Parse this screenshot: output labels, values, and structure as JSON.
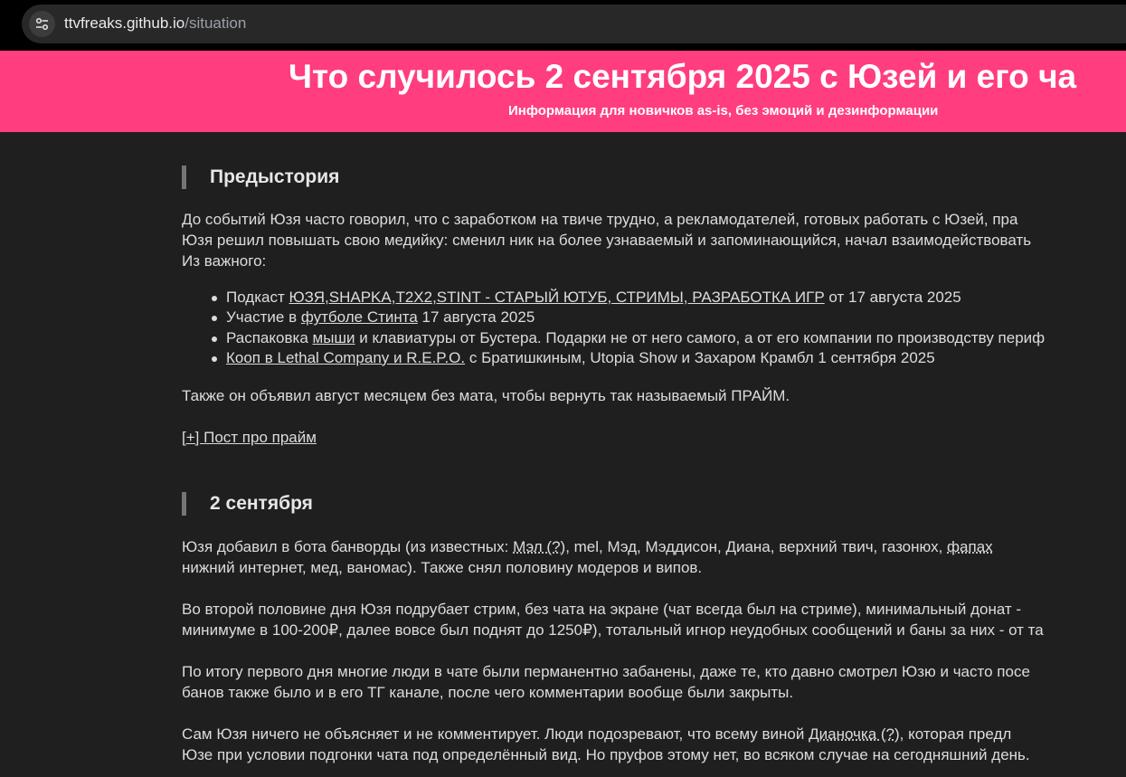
{
  "browser": {
    "url_host": "ttvfreaks.github.io",
    "url_path": "/situation",
    "site_icon": "tune-icon"
  },
  "banner": {
    "title": "Что случилось 2 сентября 2025 с Юзей и его ча",
    "subtitle": "Информация для новичков as-is, без эмоций и дезинформации"
  },
  "section1": {
    "heading": "Предыстория",
    "intro_line1": "До событий Юзя часто говорил, что с заработком на твиче трудно, а рекламодателей, готовых работать с Юзей, пра",
    "intro_line2": "Юзя решил повышать свою медийку: сменил ник на более узнаваемый и запоминающийся, начал взаимодействовать",
    "intro_line3": "Из важного:",
    "bullets": [
      {
        "pre": "Подкаст ",
        "link": "ЮЗЯ,SHAPKA,T2X2,STINT - СТАРЫЙ ЮТУБ, СТРИМЫ, РАЗРАБОТКА ИГР",
        "post": " от 17 августа 2025"
      },
      {
        "pre": "Участие в ",
        "link": "футболе Стинта",
        "post": " 17 августа 2025"
      },
      {
        "pre": "Распаковка ",
        "link": "мыши",
        "post": " и клавиатуры от Бустера. Подарки не от него самого, а от его компании по производству периф"
      },
      {
        "pre": "",
        "link": "Кооп в Lethal Company и R.E.P.O.",
        "post": " с Братишкиным, Utopia Show и Захаром Крамбл 1 сентября 2025"
      }
    ],
    "prime_note": "Также он объявил август месяцем без мата, чтобы вернуть так называемый ПРАЙМ.",
    "prime_post_link": "[+] Пост про прайм"
  },
  "section2": {
    "heading": "2 сентября",
    "p1_a": "Юзя добавил в бота банворды (из известных: ",
    "p1_link1": "Мэл (?)",
    "p1_b": ", mel, Мэд, Мэддисон, Диана, верхний твич, газонюх, ",
    "p1_link2": "фапах",
    "p1_line2": "нижний интернет, мед, ваномас). Также снял половину модеров и випов.",
    "p2_line1": "Во второй половине дня Юзя подрубает стрим, без чата на экране (чат всегда был на стриме), минимальный донат -",
    "p2_line2": "минимуме в 100-200₽, далее вовсе был поднят до 1250₽), тотальный игнор неудобных сообщений и баны за них - от та",
    "p3_line1": "По итогу первого дня многие люди в чате были перманентно забанены, даже те, кто давно смотрел Юзю и часто посе",
    "p3_line2": "банов также было и в его ТГ канале, после чего комментарии вообще были закрыты.",
    "p4_a": "Сам Юзя ничего не объясняет и не комментирует. Люди подозревают, что всему виной ",
    "p4_link": "Дианочка (?)",
    "p4_b": ", которая предл",
    "p4_line2": "Юзе при условии подгонки чата под определённый вид. Но пруфов этому нет, во всяком случае на сегодняшний день."
  }
}
